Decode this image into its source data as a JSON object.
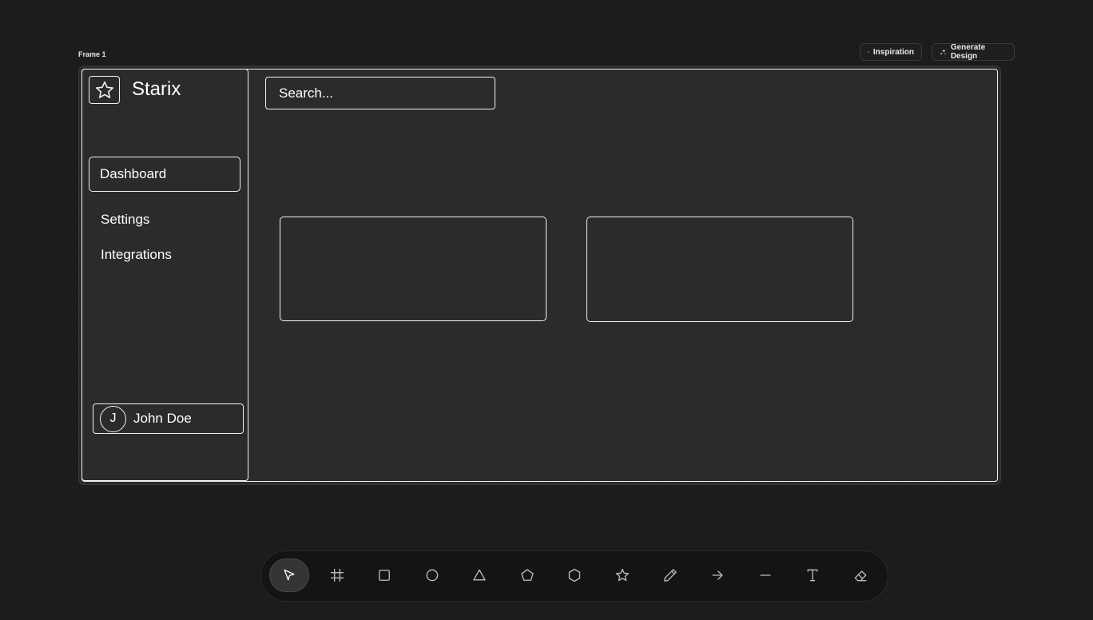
{
  "canvas": {
    "frame_label": "Frame 1"
  },
  "header_actions": {
    "inspiration_label": "Inspiration",
    "generate_label": "Generate Design"
  },
  "sidebar": {
    "brand": "Starix",
    "nav_items": [
      {
        "label": "Dashboard",
        "active": true
      },
      {
        "label": "Settings",
        "active": false
      },
      {
        "label": "Integrations",
        "active": false
      }
    ],
    "user": {
      "initial": "J",
      "name": "John Doe"
    }
  },
  "main": {
    "search_placeholder": "Search..."
  },
  "toolbar": {
    "tools": [
      "select-tool",
      "frame-tool",
      "rectangle-tool",
      "ellipse-tool",
      "triangle-tool",
      "pentagon-tool",
      "hexagon-tool",
      "star-tool",
      "pencil-tool",
      "arrow-tool",
      "line-tool",
      "text-tool",
      "eraser-tool"
    ],
    "active_tool": "select-tool"
  },
  "colors": {
    "background": "#1c1c1c",
    "frame_fill": "#2b2b2b",
    "stroke": "#f2f2f2",
    "toolbar_bg": "#141414"
  }
}
